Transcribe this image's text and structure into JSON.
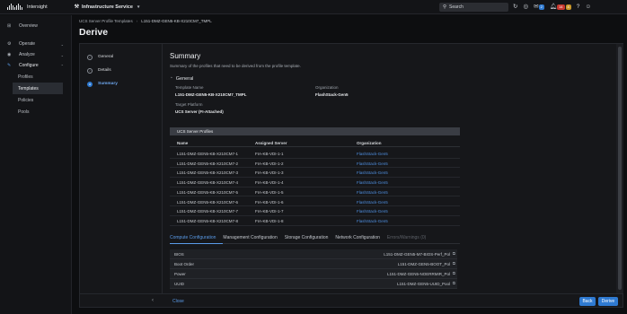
{
  "topbar": {
    "brand": "Intersight",
    "service": "Infrastructure Service",
    "search_placeholder": "Search",
    "badge_one": "2",
    "badge_two": "14",
    "badge_three": "4"
  },
  "nav": {
    "overview": "Overview",
    "operate": "Operate",
    "analyze": "Analyze",
    "configure": "Configure",
    "sub": [
      "Profiles",
      "Templates",
      "Policies",
      "Pools"
    ]
  },
  "header": {
    "crumb_parent": "UCS Server Profile Templates",
    "crumb_current": "L151-DMZ-GEN5-KB-X210CM7_TMPL",
    "title": "Derive"
  },
  "steps": [
    "General",
    "Details",
    "Summary"
  ],
  "summary": {
    "title": "Summary",
    "description": "Summary of the profiles that need to be derived from the profile template.",
    "general_label": "General",
    "template_name_label": "Template Name",
    "template_name": "L151-DMZ-GEN5-KB-X210CM7_TMPL",
    "organization_label": "Organization",
    "organization": "FlashStack-Gen5",
    "target_platform_label": "Target Platform",
    "target_platform": "UCS Server (FI-Attached)"
  },
  "profiles_table": {
    "title": "UCS Server Profiles",
    "columns": [
      "Name",
      "Assigned Server",
      "Organization"
    ],
    "rows": [
      [
        "L151-DMZ-GEN5-KB-X210CM7-1",
        "FIA-KB-VDI-1-1",
        "FlashStack-Gen5"
      ],
      [
        "L151-DMZ-GEN5-KB-X210CM7-2",
        "FIA-KB-VDI-1-2",
        "FlashStack-Gen5"
      ],
      [
        "L151-DMZ-GEN5-KB-X210CM7-3",
        "FIA-KB-VDI-1-3",
        "FlashStack-Gen5"
      ],
      [
        "L151-DMZ-GEN5-KB-X210CM7-4",
        "FIA-KB-VDI-1-4",
        "FlashStack-Gen5"
      ],
      [
        "L151-DMZ-GEN5-KB-X210CM7-5",
        "FIA-KB-VDI-1-5",
        "FlashStack-Gen5"
      ],
      [
        "L151-DMZ-GEN5-KB-X210CM7-6",
        "FIA-KB-VDI-1-6",
        "FlashStack-Gen5"
      ],
      [
        "L151-DMZ-GEN5-KB-X210CM7-7",
        "FIA-KB-VDI-1-7",
        "FlashStack-Gen5"
      ],
      [
        "L151-DMZ-GEN5-KB-X210CM7-8",
        "FIA-KB-VDI-1-8",
        "FlashStack-Gen5"
      ]
    ]
  },
  "tabs": [
    "Compute Configuration",
    "Management Configuration",
    "Storage Configuration",
    "Network Configuration",
    "Errors/Warnings (0)"
  ],
  "compute_config": [
    {
      "key": "BIOS",
      "value": "L151-DMZ-GEN5-M7-BIOS-Perf_Pol"
    },
    {
      "key": "Boot Order",
      "value": "L151-DMZ-GEN5-BOOT_Pol"
    },
    {
      "key": "Power",
      "value": "L151-DMZ-GEN5-NOERRMIR_Pol"
    },
    {
      "key": "UUID",
      "value": "L151-DMZ-GEN5-UUID_Pool"
    }
  ],
  "footer": {
    "close": "Close",
    "back": "Back",
    "derive": "Derive"
  },
  "colors": {
    "accent": "#2f7ad1",
    "link": "#4f8fe0"
  }
}
